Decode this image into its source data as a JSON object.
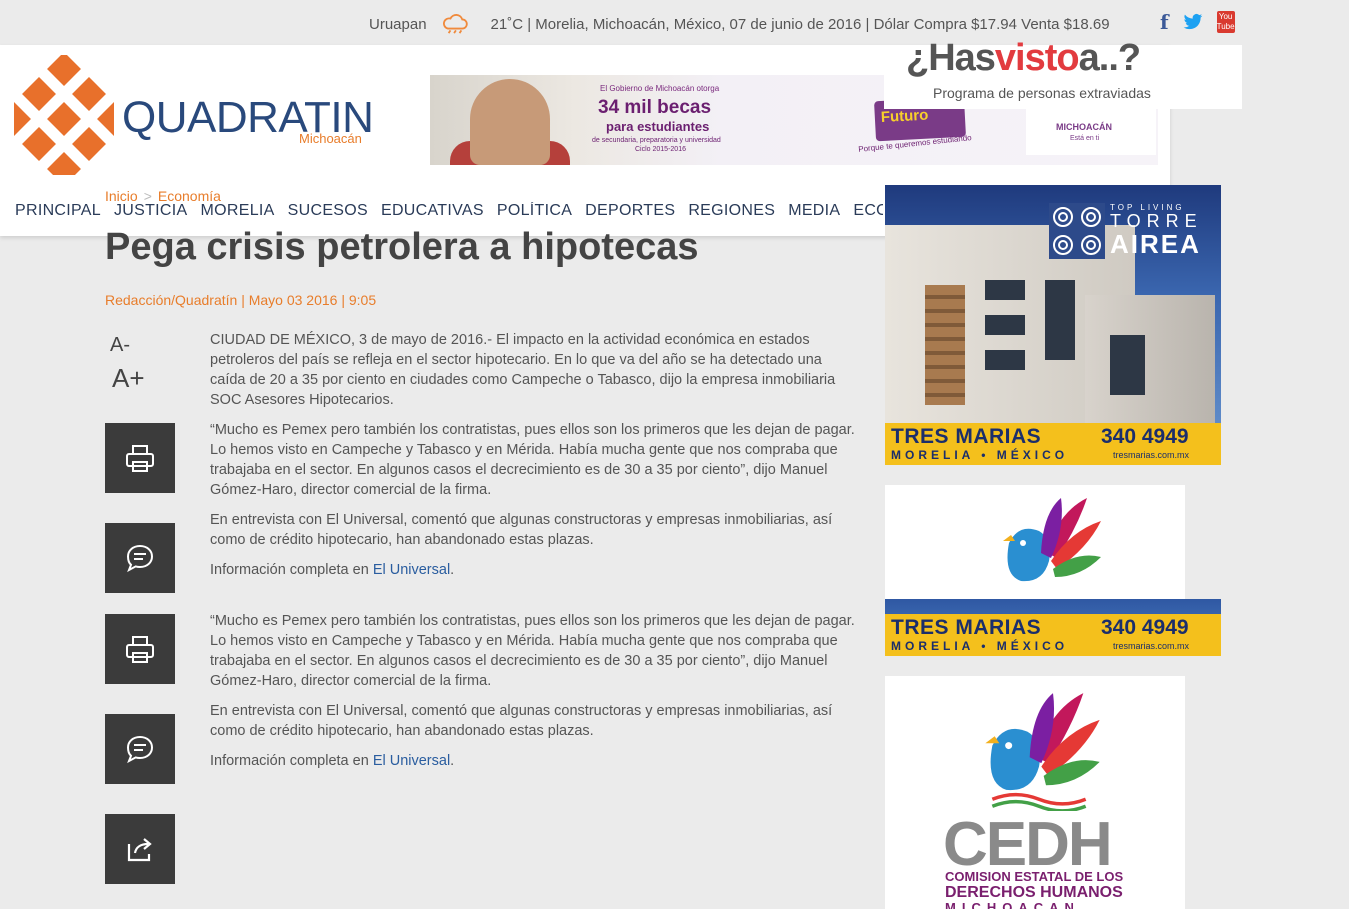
{
  "topbar": {
    "city": "Uruapan",
    "temperature": "21˚C",
    "location_date": "| Morelia, Michoacán, México, 07 de junio de 2016 |",
    "exchange": "Dólar Compra $17.94 Venta $18.69",
    "icons": [
      "cloud-rain-icon",
      "facebook-icon",
      "twitter-icon",
      "youtube-icon"
    ],
    "youtube_label": "You Tube"
  },
  "logo": {
    "name": "QUADRATIN",
    "region": "Michoacán",
    "color": "#e8702b"
  },
  "banner": {
    "line1": "El Gobierno de Michoacán otorga",
    "headline": "34 mil becas",
    "line2": "para estudiantes",
    "line3": "de secundaria, preparatoria y universidad",
    "line4": "Ciclo 2015-2016",
    "futuro": "Futuro",
    "slogan": "Porque te queremos estudiando",
    "mich": "MICHOACÁN",
    "mich_sub": "Está en ti"
  },
  "hasvisto": {
    "title_a": "¿Has",
    "title_b": "visto",
    "title_c": "a..?",
    "subtitle": "Programa de personas extraviadas"
  },
  "breadcrumb": {
    "home": "Inicio",
    "separator": ">",
    "current": "Economía"
  },
  "nav": [
    "PRINCIPAL",
    "JUSTICIA",
    "MORELIA",
    "SUCESOS",
    "EDUCATIVAS",
    "POLÍTICA",
    "DEPORTES",
    "REGIONES",
    "MEDIA",
    "ECONOMÍA"
  ],
  "article": {
    "title": "Pega crisis petrolera a hipotecas",
    "byline": "Redacción/Quadratín | Mayo 03 2016 | 9:05",
    "font_decrease": "A-",
    "font_increase": "A+",
    "p1": "CIUDAD DE MÉXICO, 3 de mayo de 2016.- El impacto en la actividad económica en estados petroleros del país se refleja en el sector hipotecario. En lo que va del año se ha detectado una caída de 20 a 35 por ciento en ciudades como Campeche o Tabasco, dijo la empresa inmobiliaria SOC Asesores Hipotecarios.",
    "p2": "“Mucho es Pemex pero también los contratistas, pues ellos son los primeros que les dejan de pagar. Lo hemos visto en Campeche y Tabasco y en Mérida. Había mucha gente que nos compraba que trabajaba en el sector. En algunos casos el decrecimiento es de 30 a 35 por ciento”, dijo Manuel Gómez-Haro, director comercial de la firma.",
    "p3": "En entrevista con El Universal, comentó que algunas constructoras y empresas inmobiliarias, así como de crédito hipotecario, han abandonado estas plazas.",
    "p4_prefix": "Información completa en ",
    "p4_link": "El Universal",
    "p4_suffix": "."
  },
  "ads": {
    "torre": {
      "top": "TOP LIVING",
      "name1": "TORRE",
      "name2": "AIREA"
    },
    "tresmarias": {
      "name": "TRES MARIAS",
      "phone": "340 4949",
      "place": "MORELIA • MÉXICO",
      "url": "tresmarias.com.mx"
    },
    "cedh": {
      "name": "CEDH",
      "line1": "COMISION ESTATAL DE LOS",
      "line2": "DERECHOS HUMANOS",
      "line3": "MICHOACAN"
    }
  }
}
